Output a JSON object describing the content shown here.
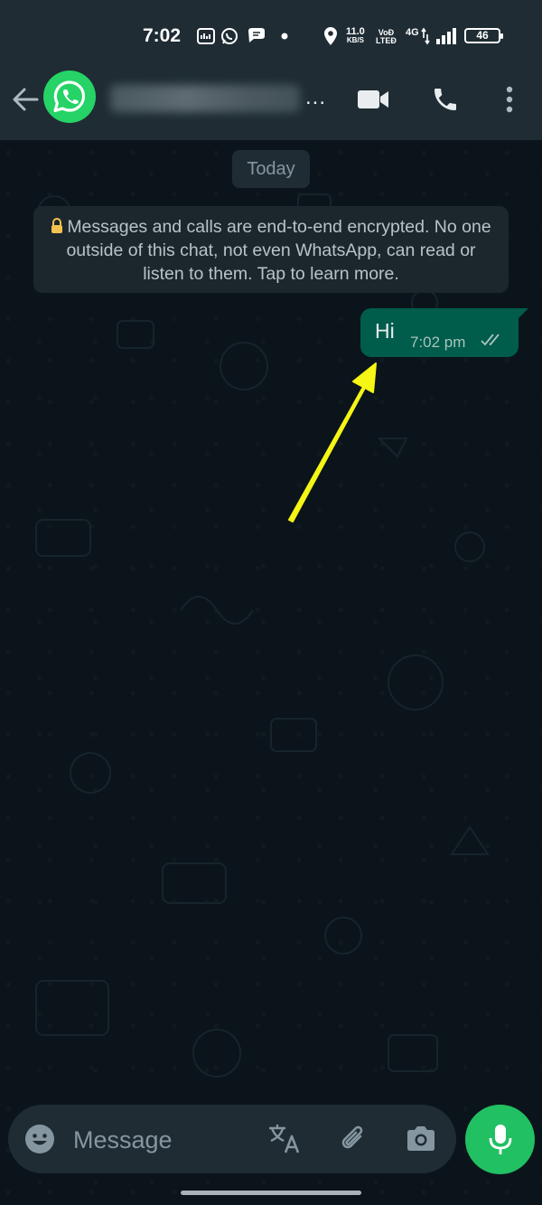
{
  "status_bar": {
    "time": "7:02",
    "network_speed": "11.0",
    "network_unit": "KB/S",
    "volte_top": "VoĐ",
    "volte_bottom": "LTEĐ",
    "network_type": "4G",
    "battery": "46"
  },
  "header": {
    "contact_name_suffix": "...",
    "icons": [
      "back-arrow-icon",
      "whatsapp-logo-icon",
      "video-call-icon",
      "voice-call-icon",
      "more-options-icon"
    ]
  },
  "chat": {
    "date_chip": "Today",
    "encryption_notice": "Messages and calls are end-to-end encrypted. No one outside of this chat, not even WhatsApp, can read or listen to them. Tap to learn more.",
    "messages": [
      {
        "text": "Hi",
        "time": "7:02 pm",
        "status": "read"
      }
    ],
    "annotation_color": "#f5f516"
  },
  "composer": {
    "placeholder": "Message"
  },
  "colors": {
    "header_bg": "#1f2c34",
    "chat_bg": "#0b141a",
    "outgoing_bubble": "#005c4b",
    "accent_green": "#21c063"
  }
}
